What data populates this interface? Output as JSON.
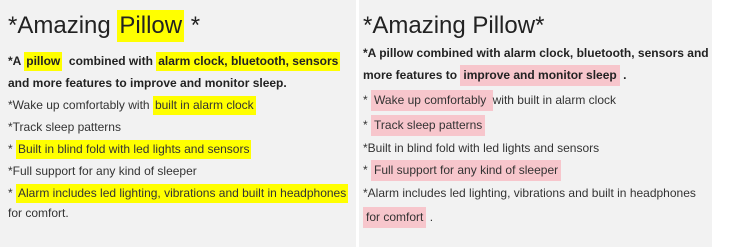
{
  "accents": {
    "yellow_highlight": "#ffff00",
    "pink_highlight": "#f7c6cc",
    "panel_bg": "#f2f2f2"
  },
  "left": {
    "title_pre": "*Amazing ",
    "title_hl": "Pillow",
    "title_post": " *",
    "l1_a": "*A ",
    "l1_hl1": "pillow",
    "l1_b": "  combined with ",
    "l1_hl2": "alarm clock, bluetooth, sensors",
    "l2": "and more features to improve and monitor sleep.",
    "l3_a": "*Wake up comfortably with ",
    "l3_hl": "built in alarm clock",
    "l4": "*Track sleep patterns",
    "l5_a": "* ",
    "l5_hl": "Built in blind fold with led lights and sensors",
    "l6": "*Full support for any kind of sleeper",
    "l7_a": "* ",
    "l7_hl": "Alarm includes led lighting, vibrations and built in headphones",
    "l8": "for comfort."
  },
  "right": {
    "title": "*Amazing Pillow*",
    "l1": "*A pillow combined with alarm clock, bluetooth, sensors and",
    "l2_a": "more features to ",
    "l2_hl": "improve and monitor sleep",
    "l2_b": " .",
    "l3_a": "* ",
    "l3_hl": "Wake up comfortably ",
    "l3_b": " with built in alarm clock",
    "l4_a": "* ",
    "l4_hl": "Track sleep patterns",
    "l5": "*Built in blind fold with led lights and sensors",
    "l6_a": "* ",
    "l6_hl": "Full support for any kind of sleeper",
    "l7": "*Alarm includes led lighting, vibrations and built in headphones",
    "l8_a": " ",
    "l8_hl": "for comfort",
    "l8_b": " ."
  }
}
